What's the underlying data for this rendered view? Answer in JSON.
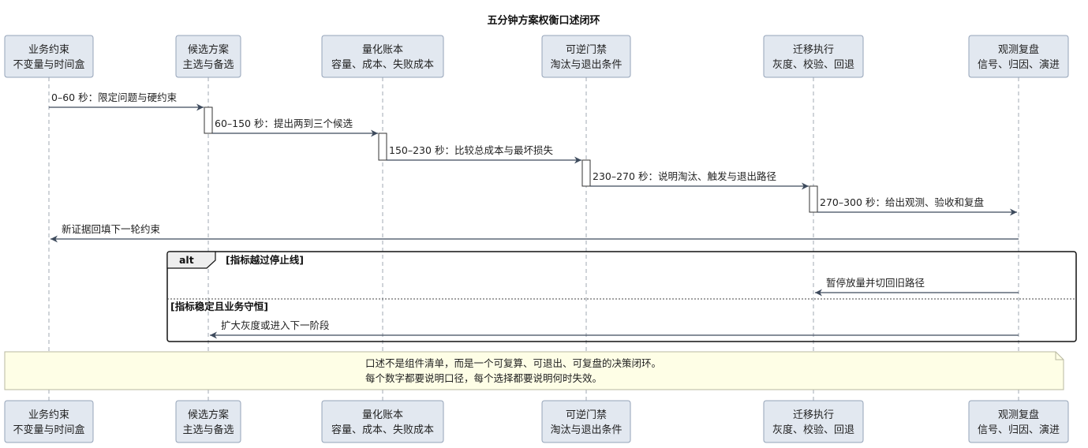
{
  "title": "五分钟方案权衡口述闭环",
  "participants": [
    {
      "id": "p0",
      "line1": "业务约束",
      "line2": "不变量与时间盒"
    },
    {
      "id": "p1",
      "line1": "候选方案",
      "line2": "主选与备选"
    },
    {
      "id": "p2",
      "line1": "量化账本",
      "line2": "容量、成本、失败成本"
    },
    {
      "id": "p3",
      "line1": "可逆门禁",
      "line2": "淘汰与退出条件"
    },
    {
      "id": "p4",
      "line1": "迁移执行",
      "line2": "灰度、校验、回退"
    },
    {
      "id": "p5",
      "line1": "观测复盘",
      "line2": "信号、归因、演进"
    }
  ],
  "messages": [
    {
      "from": "p0",
      "to": "p1",
      "text": "0–60 秒：限定问题与硬约束"
    },
    {
      "from": "p1",
      "to": "p2",
      "text": "60–150 秒：提出两到三个候选"
    },
    {
      "from": "p2",
      "to": "p3",
      "text": "150–230 秒：比较总成本与最坏损失"
    },
    {
      "from": "p3",
      "to": "p4",
      "text": "230–270 秒：说明淘汰、触发与退出路径"
    },
    {
      "from": "p4",
      "to": "p5",
      "text": "270–300 秒：给出观测、验收和复盘"
    },
    {
      "from": "p5",
      "to": "p0",
      "text": "新证据回填下一轮约束"
    }
  ],
  "alt": {
    "keyword": "alt",
    "branch1": {
      "guard": "[指标越过停止线]",
      "message": {
        "from": "p5",
        "to": "p4",
        "text": "暂停放量并切回旧路径"
      }
    },
    "branch2": {
      "guard": "[指标稳定且业务守恒]",
      "message": {
        "from": "p5",
        "to": "p1",
        "text": "扩大灰度或进入下一阶段"
      }
    }
  },
  "note": {
    "line1": "口述不是组件清单，而是一个可复算、可退出、可复盘的决策闭环。",
    "line2": "每个数字都要说明口径，每个选择都要说明何时失效。"
  },
  "colors": {
    "participant_fill": "#e2e8f0",
    "participant_border": "#94a3b8",
    "arrow": "#3d4a5c",
    "lifeline": "#a0a8b3",
    "note_fill": "#fefee6",
    "note_border": "#b8b8a0",
    "frame_border": "#111111",
    "tab_fill": "#eeeeee"
  }
}
